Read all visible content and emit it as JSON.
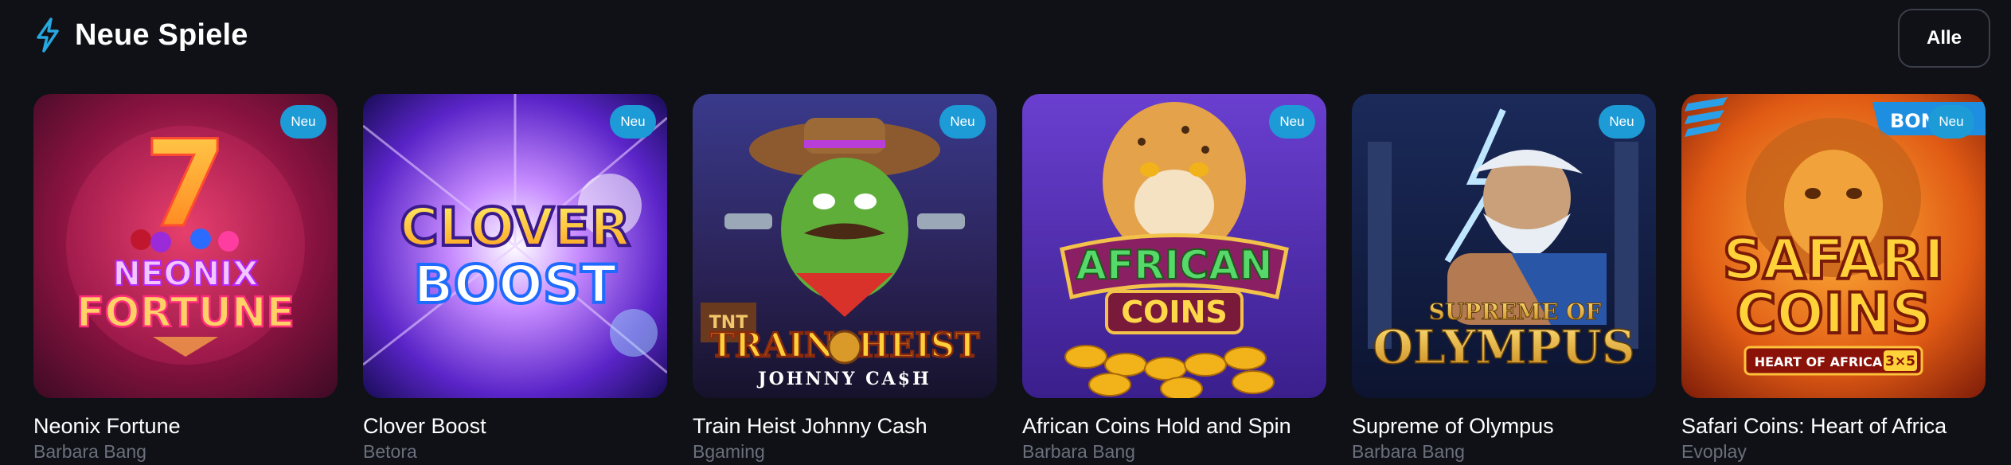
{
  "header": {
    "title": "Neue Spiele",
    "icon": "lightning-bolt-icon",
    "all_label": "Alle"
  },
  "colors": {
    "background": "#0f1116",
    "accent": "#27a8e0",
    "badge": "#1d9bd6",
    "provider_text": "#6a6f7c"
  },
  "games": [
    {
      "name": "Neonix Fortune",
      "provider": "Barbara Bang",
      "badge": "Neu",
      "art_lines": [
        "7",
        "NEONIX",
        "FORTUNE"
      ]
    },
    {
      "name": "Clover Boost",
      "provider": "Betora",
      "badge": "Neu",
      "art_lines": [
        "CLOVER",
        "BOOST"
      ]
    },
    {
      "name": "Train Heist Johnny Cash",
      "provider": "Bgaming",
      "badge": "Neu",
      "art_lines": [
        "TNT",
        "TRAIN",
        "HEIST",
        "JOHNNY CA$H"
      ]
    },
    {
      "name": "African Coins Hold and Spin",
      "provider": "Barbara Bang",
      "badge": "Neu",
      "art_lines": [
        "AFRICAN",
        "COINS"
      ]
    },
    {
      "name": "Supreme of Olympus",
      "provider": "Barbara Bang",
      "badge": "Neu",
      "art_lines": [
        "SUPREME OF",
        "OLYMPUS"
      ]
    },
    {
      "name": "Safari Coins: Heart of Africa",
      "provider": "Evoplay",
      "badge": "Neu",
      "art_lines": [
        "BONU",
        "SAFARI",
        "COINS",
        "HEART OF AFRICA",
        "3×5"
      ]
    }
  ]
}
